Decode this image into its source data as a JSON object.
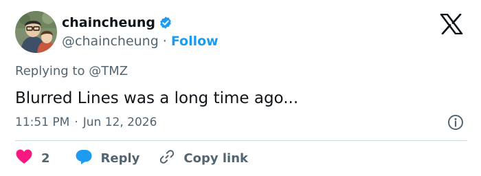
{
  "user": {
    "display_name": "chaincheung",
    "handle": "@chaincheung",
    "separator": "·",
    "follow_label": "Follow"
  },
  "tweet": {
    "replying_prefix": "Replying to ",
    "replying_to": "@TMZ",
    "text": "Blurred Lines was a long time ago...",
    "time": "11:51 PM",
    "separator": "·",
    "date": "Jun 12, 2026"
  },
  "actions": {
    "like_count": "2",
    "reply_label": "Reply",
    "copy_label": "Copy link"
  },
  "colors": {
    "accent": "#1d9bf0",
    "like": "#f91880",
    "text_primary": "#0f1419",
    "text_secondary": "#536471",
    "divider": "#cfd9de"
  },
  "icons": [
    "verified-badge-icon",
    "x-logo-icon",
    "info-icon",
    "heart-icon",
    "reply-bubble-icon",
    "link-icon"
  ]
}
